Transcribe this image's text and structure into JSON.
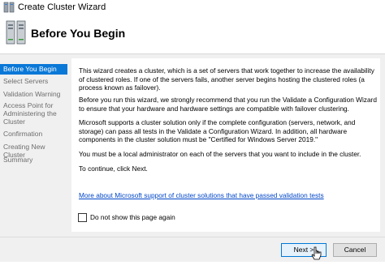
{
  "window": {
    "title": "Create Cluster Wizard",
    "title_icon": "cluster-wizard-icon"
  },
  "header": {
    "title": "Before You Begin",
    "icon": "cluster-servers-icon"
  },
  "sidebar": {
    "items": [
      {
        "label": "Before You Begin",
        "active": true
      },
      {
        "label": "Select Servers",
        "active": false
      },
      {
        "label": "Validation Warning",
        "active": false
      },
      {
        "label": "Access Point for Administering the Cluster",
        "active": false
      },
      {
        "label": "Confirmation",
        "active": false
      },
      {
        "label": "Creating New Cluster",
        "active": false
      },
      {
        "label": "Summary",
        "active": false
      }
    ]
  },
  "main": {
    "paragraphs": [
      "This wizard creates a cluster, which is a set of servers that work together to increase the availability of clustered roles. If one of the servers fails, another server begins hosting the clustered roles (a process known as failover).",
      "Before you run this wizard, we strongly recommend that you run the Validate a Configuration Wizard to ensure that your hardware and hardware settings are compatible with failover clustering.",
      "Microsoft supports a cluster solution only if the complete configuration (servers, network, and storage) can pass all tests in the Validate a Configuration Wizard. In addition, all hardware components in the cluster solution must be \"Certified for Windows Server 2019.\"",
      "You must be a local administrator on each of the servers that you want to include in the cluster.",
      "To continue, click Next."
    ],
    "support_link": "More about Microsoft support of cluster solutions that have passed validation tests",
    "checkbox_label": "Do not show this page again",
    "checkbox_checked": false
  },
  "footer": {
    "next_label": "Next >",
    "cancel_label": "Cancel"
  },
  "colors": {
    "selection": "#0a78d7",
    "link": "#0046c8",
    "panel": "#f0f0f0"
  }
}
